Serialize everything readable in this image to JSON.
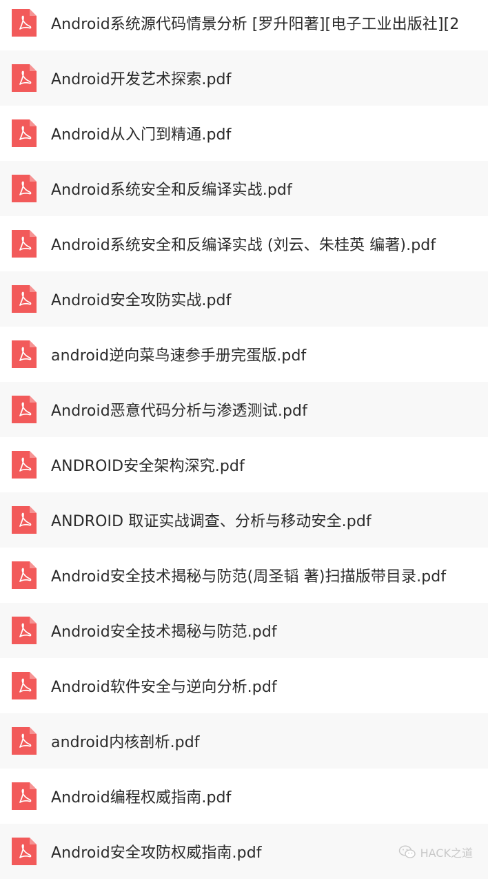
{
  "files": [
    {
      "name": "Android系统源代码情景分析 [罗升阳著][电子工业出版社][2",
      "icon": "pdf-icon"
    },
    {
      "name": "Android开发艺术探索.pdf",
      "icon": "pdf-icon"
    },
    {
      "name": "Android从入门到精通.pdf",
      "icon": "pdf-icon"
    },
    {
      "name": "Android系统安全和反编译实战.pdf",
      "icon": "pdf-icon"
    },
    {
      "name": "Android系统安全和反编译实战 (刘云、朱桂英 编著).pdf",
      "icon": "pdf-icon"
    },
    {
      "name": "Android安全攻防实战.pdf",
      "icon": "pdf-icon"
    },
    {
      "name": "android逆向菜鸟速参手册完蛋版.pdf",
      "icon": "pdf-icon"
    },
    {
      "name": "Android恶意代码分析与渗透测试.pdf",
      "icon": "pdf-icon"
    },
    {
      "name": "ANDROID安全架构深究.pdf",
      "icon": "pdf-icon"
    },
    {
      "name": "ANDROID 取证实战调查、分析与移动安全.pdf",
      "icon": "pdf-icon"
    },
    {
      "name": "Android安全技术揭秘与防范(周圣韬 著)扫描版带目录.pdf",
      "icon": "pdf-icon"
    },
    {
      "name": "Android安全技术揭秘与防范.pdf",
      "icon": "pdf-icon"
    },
    {
      "name": "Android软件安全与逆向分析.pdf",
      "icon": "pdf-icon"
    },
    {
      "name": "android内核剖析.pdf",
      "icon": "pdf-icon"
    },
    {
      "name": "Android编程权威指南.pdf",
      "icon": "pdf-icon"
    },
    {
      "name": "Android安全攻防权威指南.pdf",
      "icon": "pdf-icon"
    }
  ],
  "watermark": {
    "text": "HACK之道",
    "icon": "wechat-icon"
  },
  "colors": {
    "pdf_icon": "#f25a5a",
    "text": "#2b2b2b",
    "row_alt": "#f8f8f8",
    "watermark": "#c8c8c8"
  }
}
